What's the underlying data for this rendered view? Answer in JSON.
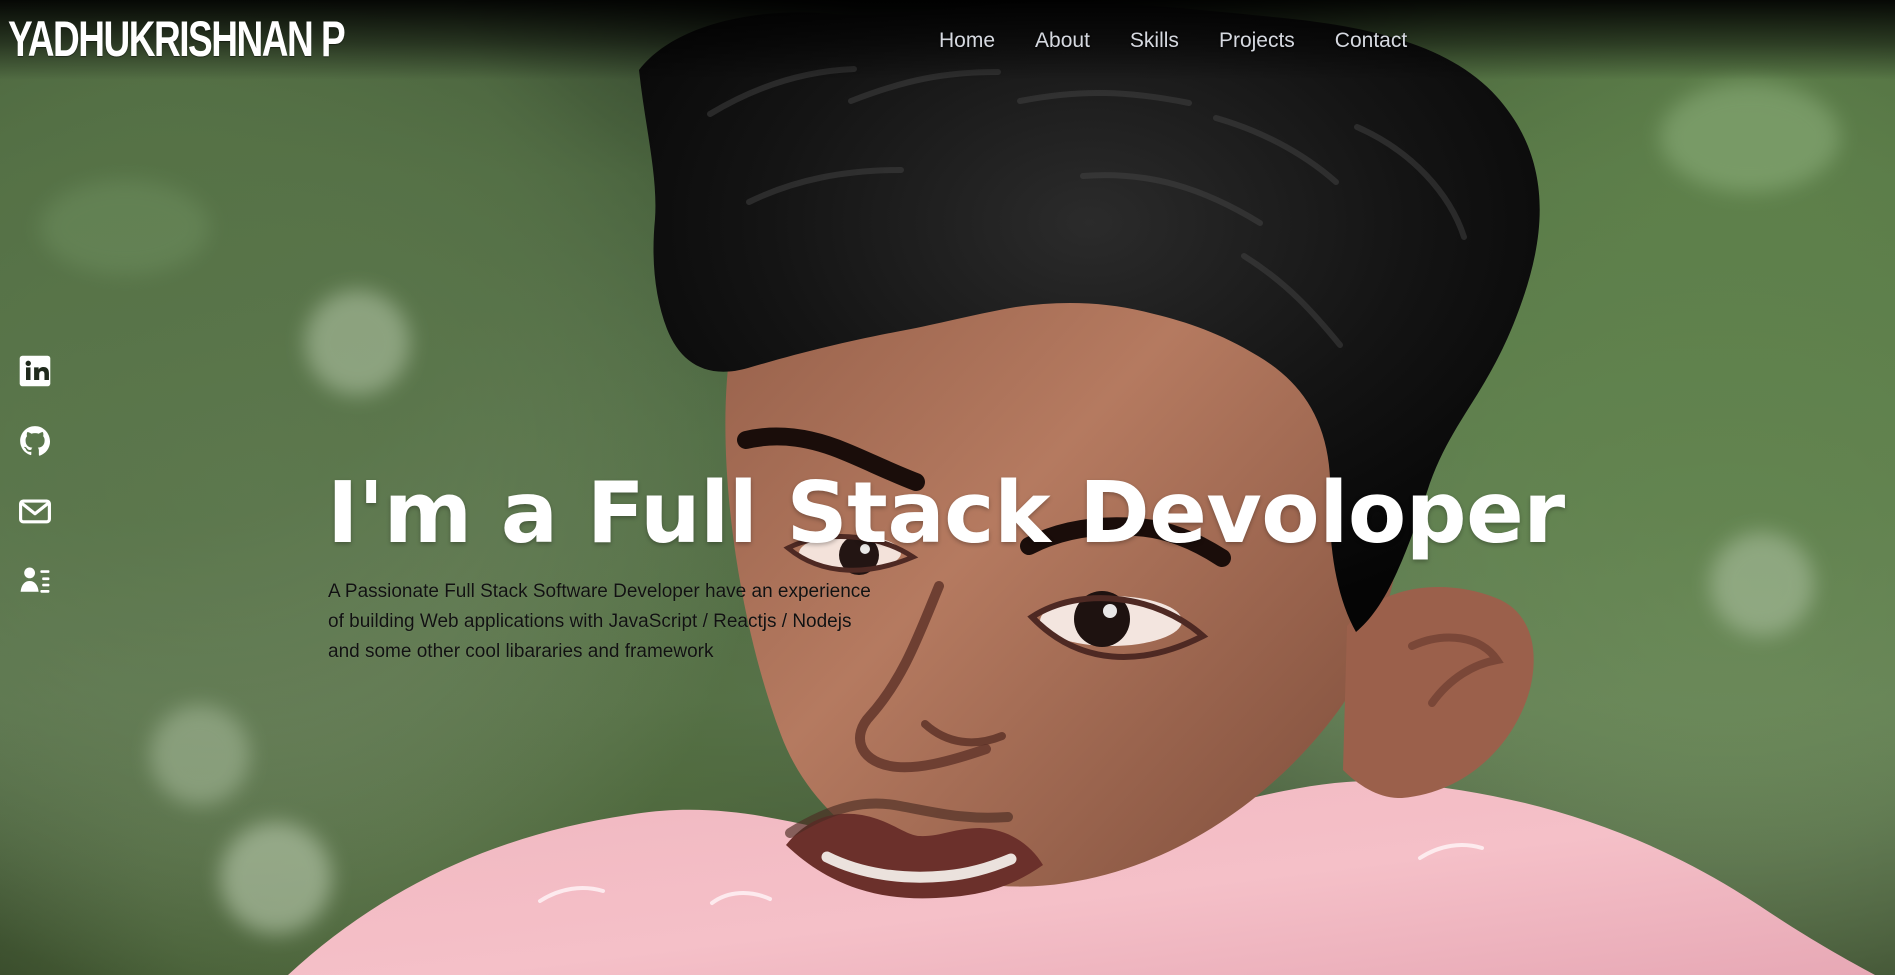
{
  "header": {
    "brand": "YADHUKRISHNAN P",
    "nav": [
      "Home",
      "About",
      "Skills",
      "Projects",
      "Contact"
    ]
  },
  "social": [
    {
      "icon": "linkedin-icon"
    },
    {
      "icon": "github-icon"
    },
    {
      "icon": "mail-icon"
    },
    {
      "icon": "contact-card-icon"
    }
  ],
  "hero": {
    "headline": "I'm a Full Stack Devoloper",
    "intro_lines": [
      "A Passionate Full Stack Software Developer have an experience",
      "of building Web applications with JavaScript / Reactjs / Nodejs",
      "and some other cool libararies and framework"
    ]
  },
  "colors": {
    "text": "#ffffff",
    "nav": "#d6d9e0",
    "intro": "#111111",
    "foliage": "#5b7550",
    "shirt": "#f3b8c0",
    "hair": "#141414"
  }
}
